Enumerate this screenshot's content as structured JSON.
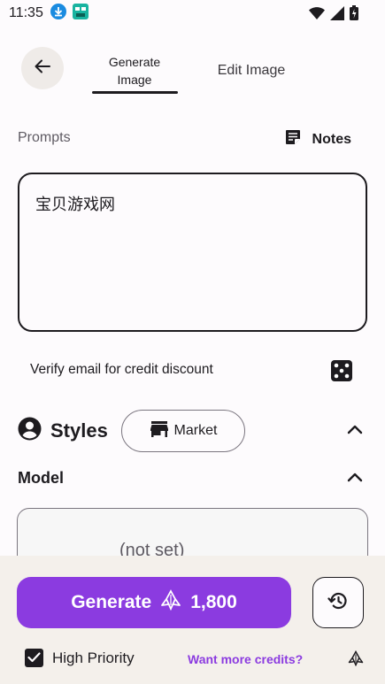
{
  "status_bar": {
    "time": "11:35"
  },
  "tabs": {
    "generate": "Generate\nImage",
    "generate_line1": "Generate",
    "generate_line2": "Image",
    "edit": "Edit Image"
  },
  "prompts": {
    "label": "Prompts",
    "notes_label": "Notes",
    "value": "宝贝游戏网"
  },
  "verify": {
    "text": "Verify email for credit discount"
  },
  "styles": {
    "title": "Styles",
    "market_label": "Market"
  },
  "model": {
    "title": "Model",
    "value": "(not set)"
  },
  "generate": {
    "label": "Generate",
    "cost": "1,800"
  },
  "priority": {
    "label": "High Priority",
    "checked": true
  },
  "credits": {
    "link": "Want more credits?"
  },
  "colors": {
    "accent": "#8b3be0",
    "panel": "#f4f0eb",
    "text": "#1d1b1f"
  },
  "icons": [
    "download-icon",
    "app-icon",
    "wifi-icon",
    "signal-icon",
    "battery-icon",
    "back-arrow-icon",
    "notes-icon",
    "dice-icon",
    "account-icon",
    "store-icon",
    "chevron-up-icon",
    "credits-icon",
    "history-icon",
    "check-icon"
  ]
}
